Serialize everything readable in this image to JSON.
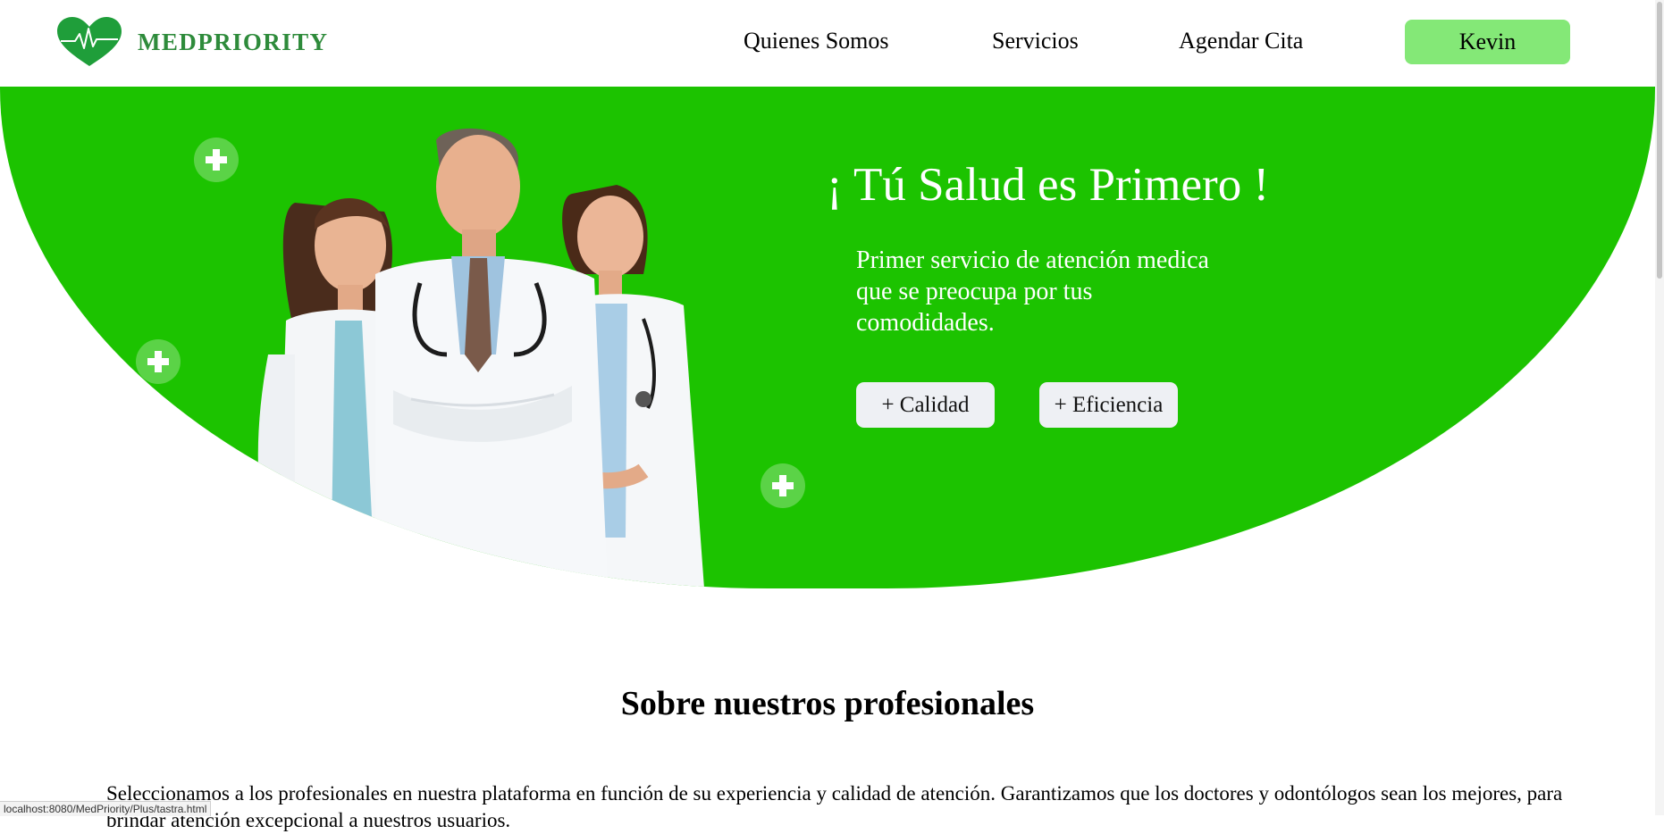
{
  "header": {
    "brand": "MEDPRIORITY",
    "logo_icon": "heart-pulse-icon",
    "nav": {
      "quienes": "Quienes Somos",
      "servicios": "Servicios",
      "agendar": "Agendar Cita"
    },
    "user_button": "Kevin"
  },
  "hero": {
    "title": "¡ Tú Salud es Primero !",
    "text": "Primer servicio de atención medica que se preocupa por tus comodidades.",
    "pills": {
      "calidad": "+ Calidad",
      "eficiencia": "+ Eficiencia"
    },
    "image": "three-doctors-photo",
    "colors": {
      "hero_bg": "#1cc300",
      "accent_button": "#84e877",
      "brand": "#2e8b3b"
    }
  },
  "about": {
    "title": "Sobre nuestros profesionales",
    "text": "Seleccionamos a los profesionales en nuestra plataforma en función de su experiencia y calidad de atención. Garantizamos que los doctores y odontólogos sean los mejores, para brindar atención excepcional a nuestros usuarios."
  },
  "status_bar": {
    "url": "localhost:8080/MedPriority/Plus/tastra.html"
  }
}
